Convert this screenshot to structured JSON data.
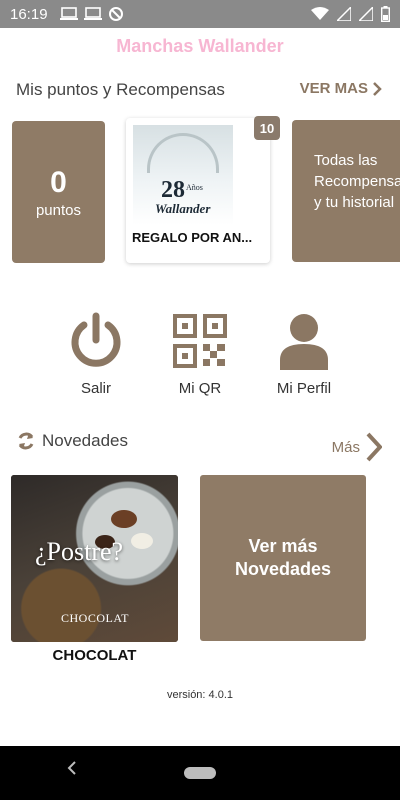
{
  "status_bar": {
    "time": "16:19",
    "left_icons": [
      "laptop-icon",
      "laptop-icon",
      "data-saver-icon"
    ],
    "right_icons": [
      "wifi-icon",
      "signal-icon",
      "signal-icon",
      "battery-icon"
    ]
  },
  "app": {
    "title": "Manchas Wallander"
  },
  "rewards": {
    "section_title": "Mis puntos y Recompensas",
    "ver_mas_label": "VER MAS",
    "points_value": "0",
    "points_label": "puntos",
    "reward_title": "REGALO POR AN...",
    "reward_badge": "10",
    "reward_image": {
      "number": "28",
      "subtitle": "Años",
      "name": "Wallander"
    },
    "all_rewards_label": "Todas las Recompensas y tu historial"
  },
  "actions": [
    {
      "label": "Salir",
      "icon": "power-icon"
    },
    {
      "label": "Mi QR",
      "icon": "qr-code-icon"
    },
    {
      "label": "Mi Perfil",
      "icon": "user-icon"
    }
  ],
  "news": {
    "section_title": "Novedades",
    "mas_label": "Más",
    "item_image_text": "¿Postre?",
    "item_image_brand": "CHOCOLAT",
    "item_caption": "CHOCOLAT",
    "more_label_line1": "Ver más",
    "more_label_line2": "Novedades"
  },
  "version_text": "versión: 4.0.1",
  "colors": {
    "brand_pink": "#f7b6d2",
    "accent_brown": "#8f7b66",
    "icon_brown": "#8b7763"
  }
}
